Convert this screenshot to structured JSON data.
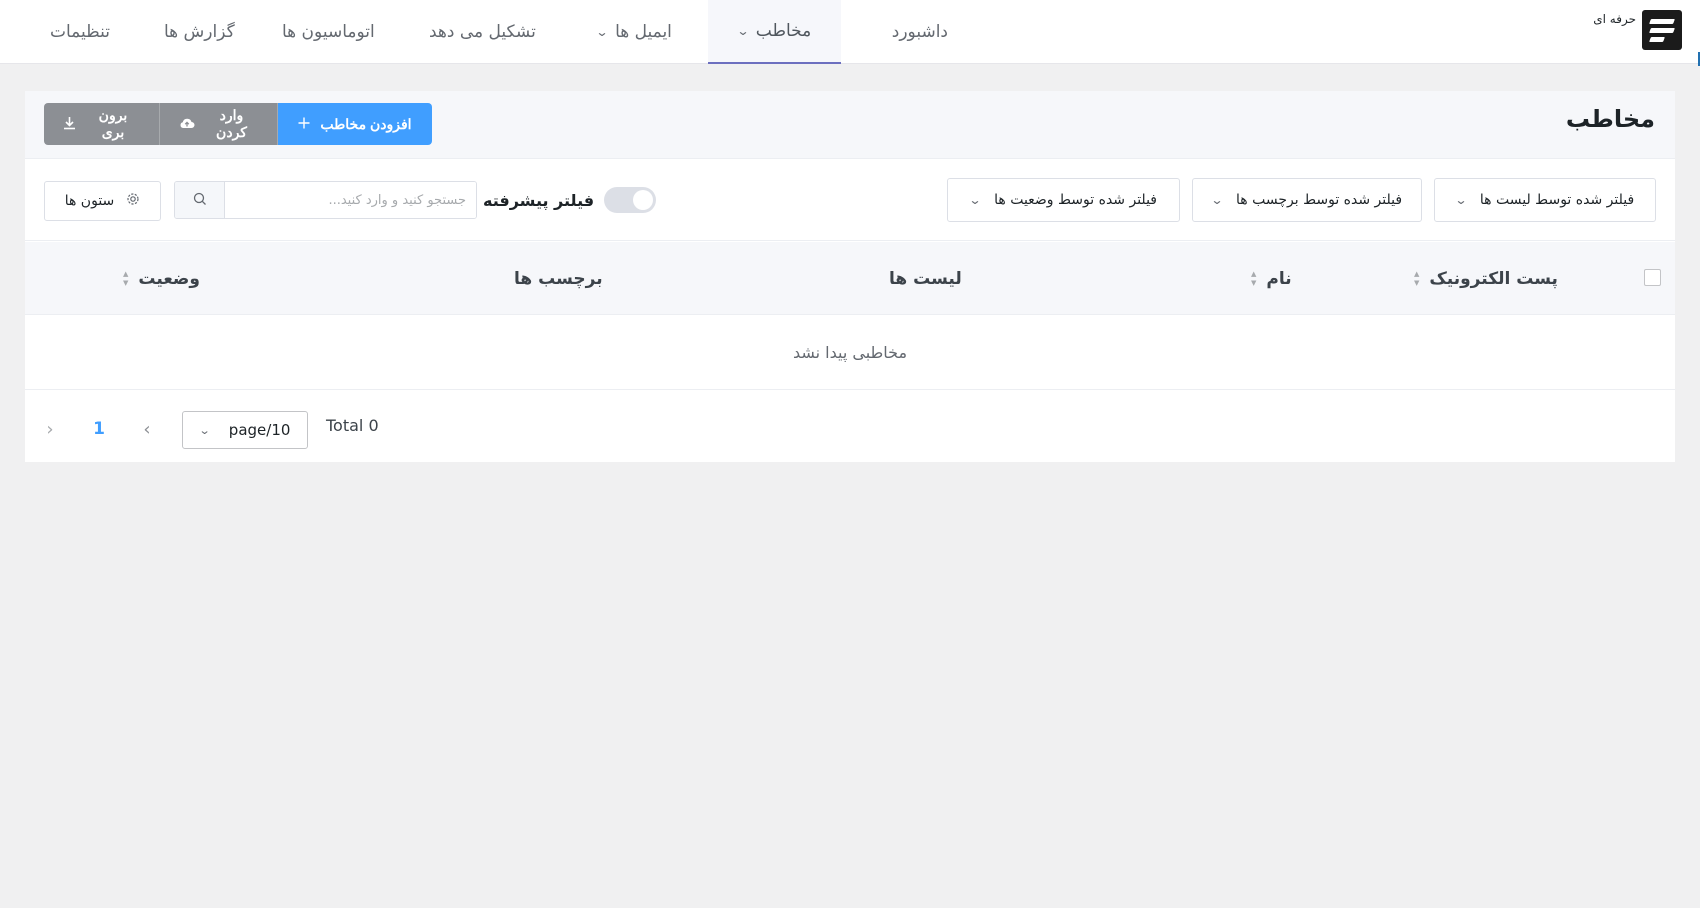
{
  "brand": {
    "text": "حرفه ای",
    "logo_icon": "brand-logo-icon"
  },
  "nav": {
    "dashboard": "داشبورد",
    "contacts": "مخاطب",
    "emails": "ایمیل ها",
    "forms": "تشکیل می دهد",
    "automations": "اتوماسیون ها",
    "reports": "گزارش ها",
    "settings": "تنظیمات",
    "active": "contacts"
  },
  "header": {
    "title": "مخاطب",
    "add_contact": "افزودن مخاطب",
    "import": "وارد کردن",
    "export": "برون بری"
  },
  "filters": {
    "by_lists": "فیلتر شده توسط لیست ها",
    "by_tags": "فیلتر شده توسط برچسب ها",
    "by_status": "فیلتر شده توسط وضعیت ها",
    "advanced_filter": "فیلتر پیشرفته",
    "advanced_enabled": false,
    "search_placeholder": "جستجو کنید و وارد کنید...",
    "search_value": "",
    "columns": "ستون ها"
  },
  "table": {
    "columns": [
      "پست الکترونیک",
      "نام",
      "لیست ها",
      "برچسب ها",
      "وضعیت"
    ],
    "rows": [],
    "empty_text": "مخاطبی پیدا نشد"
  },
  "pagination": {
    "total": "Total 0",
    "page_size": "page/10",
    "current_page": "1"
  },
  "colors": {
    "primary": "#409eff",
    "secondary": "#8c8f94",
    "background": "#f0f0f1",
    "active_nav_border": "#6c6fbf"
  }
}
